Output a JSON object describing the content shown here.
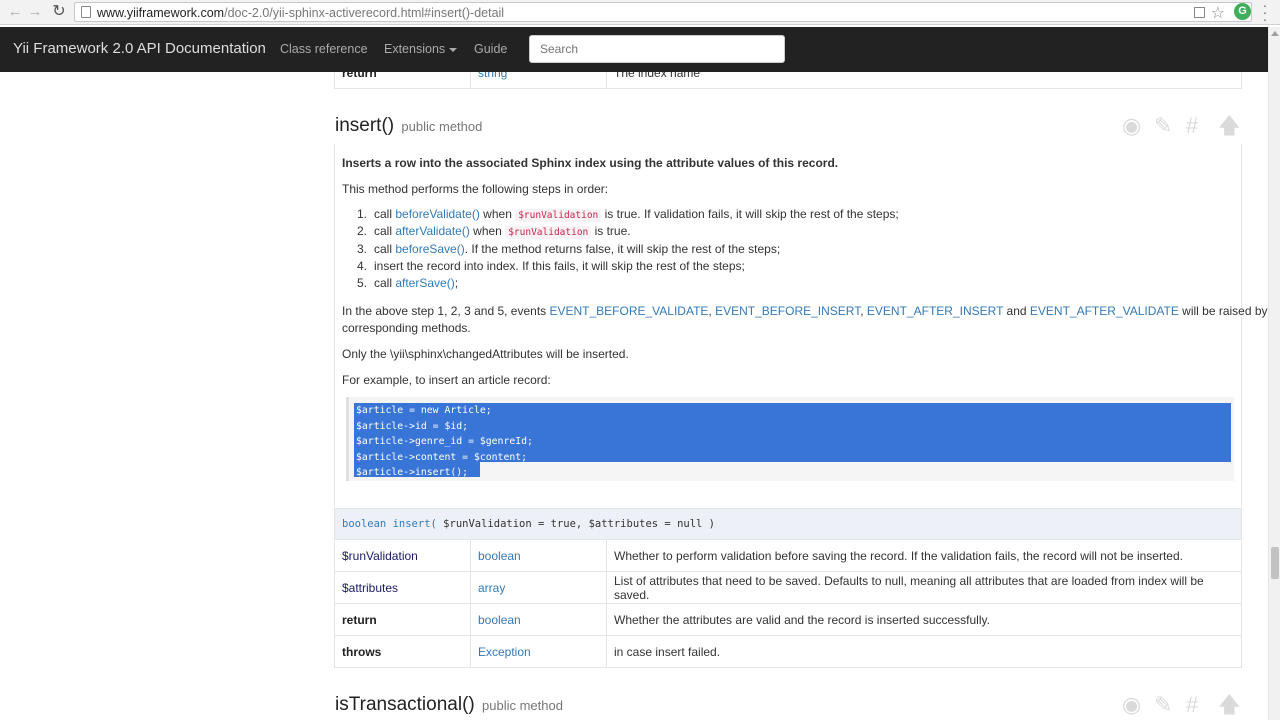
{
  "browser": {
    "url_domain": "www.yiiframework.com",
    "url_path": "/doc-2.0/yii-sphinx-activerecord.html#insert()-detail",
    "back_icon": "arrow-left-icon",
    "forward_icon": "arrow-right-icon",
    "reload_icon": "reload-icon",
    "star_icon": "star-icon",
    "extension_label": "G"
  },
  "navbar": {
    "brand": "Yii Framework 2.0 API Documentation",
    "links": [
      "Class reference",
      "Extensions",
      "Guide"
    ],
    "search_placeholder": "Search"
  },
  "prev_table_row": {
    "name": "return",
    "type": "string",
    "description": "The index name"
  },
  "insert_method": {
    "name": "insert()",
    "visibility": "public method",
    "summary": "Inserts a row into the associated Sphinx index using the attribute values of this record.",
    "intro": "This method performs the following steps in order:",
    "steps": [
      {
        "num": "1.",
        "pre": "call ",
        "link": "beforeValidate()",
        "mid": " when ",
        "code": "$runValidation",
        "post": " is true. If validation fails, it will skip the rest of the steps;"
      },
      {
        "num": "2.",
        "pre": "call ",
        "link": "afterValidate()",
        "mid": " when ",
        "code": "$runValidation",
        "post": " is true."
      },
      {
        "num": "3.",
        "pre": "call ",
        "link": "beforeSave()",
        "mid": "",
        "code": "",
        "post": ". If the method returns false, it will skip the rest of the steps;"
      },
      {
        "num": "4.",
        "pre": "insert the record into index. If this fails, it will skip the rest of the steps;",
        "link": "",
        "mid": "",
        "code": "",
        "post": ""
      },
      {
        "num": "5.",
        "pre": "call ",
        "link": "afterSave()",
        "mid": "",
        "code": "",
        "post": ";"
      }
    ],
    "events_line1_pre": "In the above step 1, 2, 3 and 5, events ",
    "events": [
      "EVENT_BEFORE_VALIDATE",
      "EVENT_BEFORE_INSERT",
      "EVENT_AFTER_INSERT",
      "EVENT_AFTER_VALIDATE"
    ],
    "events_sep": ", ",
    "events_and": " and ",
    "events_line1_post": " will be raised by the",
    "events_line2": "corresponding methods.",
    "changed_attrs": "Only the \\yii\\sphinx\\changedAttributes will be inserted.",
    "example_intro": "For example, to insert an article record:",
    "code_lines": [
      "$article = new Article;",
      "$article->id = $id;",
      "$article->genre_id = $genreId;",
      "$article->content = $content;",
      "$article->insert();"
    ],
    "signature": {
      "return_type": "boolean",
      "name": "insert(",
      "params": " $runValidation = true, $attributes = null )"
    },
    "params_table": [
      {
        "name": "$runValidation",
        "type": "boolean",
        "description": "Whether to perform validation before saving the record. If the validation fails, the record will not be inserted."
      },
      {
        "name": "$attributes",
        "type": "array",
        "description": "List of attributes that need to be saved. Defaults to null, meaning all attributes that are loaded from index will be saved."
      },
      {
        "name": "return",
        "type": "boolean",
        "description": "Whether the attributes are valid and the record is inserted successfully."
      },
      {
        "name": "throws",
        "type": "Exception",
        "description": "in case insert failed."
      }
    ]
  },
  "next_method": {
    "name": "isTransactional()",
    "visibility": "public method"
  },
  "tool_icons": [
    "eye-icon",
    "pencil-icon",
    "hash-icon",
    "arrow-up-icon"
  ],
  "colors": {
    "link": "#337ab7",
    "navbar_bg": "#222222",
    "selection": "#3875d7",
    "signature_bg": "#eef0f8"
  }
}
